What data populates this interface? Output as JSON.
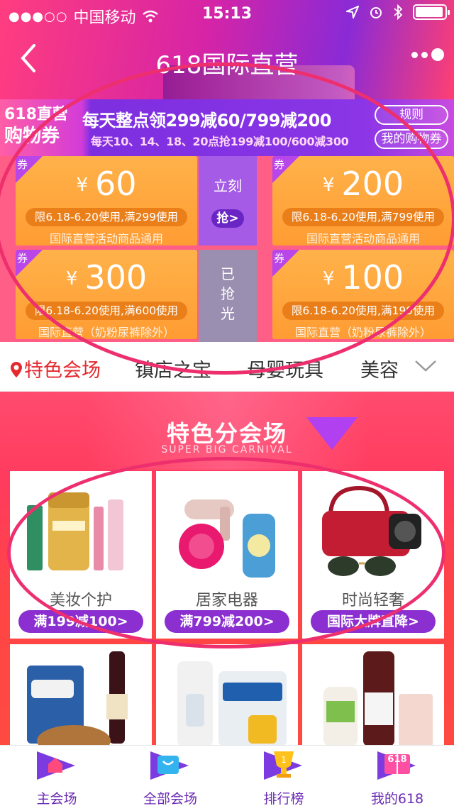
{
  "status_bar": {
    "carrier": "中国移动",
    "time": "15:13"
  },
  "nav": {
    "title": "618国际直营"
  },
  "coupon_banner": {
    "left_line1": "618直营",
    "left_line2": "购物券",
    "line1": "每天整点领299减60/799减200",
    "line2": "每天10、14、18、20点抢199减100/600减300",
    "rule_button": "规则",
    "mine_button": "我的购物券"
  },
  "coupons": [
    {
      "tag": "券",
      "currency": "¥",
      "amount": "60",
      "limit": "限6.18-6.20使用,满299使用",
      "scope": "国际直营活动商品通用"
    },
    {
      "tag": "券",
      "currency": "¥",
      "amount": "200",
      "limit": "限6.18-6.20使用,满799使用",
      "scope": "国际直营活动商品通用"
    },
    {
      "tag": "券",
      "currency": "¥",
      "amount": "300",
      "limit": "限6.18-6.20使用,满600使用",
      "scope": "国际直营（奶粉尿裤除外）"
    },
    {
      "tag": "券",
      "currency": "¥",
      "amount": "100",
      "limit": "限6.18-6.20使用,满199使用",
      "scope": "国际直营（奶粉尿裤除外）"
    }
  ],
  "grab": {
    "label": "立刻",
    "button": "抢>"
  },
  "soldout": {
    "line1": "已",
    "line2": "抢",
    "line3": "光"
  },
  "tabs": {
    "active": "特色会场",
    "t2": "镇店之宝",
    "t3": "母婴玩具",
    "t4": "美容"
  },
  "venue": {
    "title": "特色分会场",
    "subtitle": "SUPER BIG CARNIVAL"
  },
  "cards": [
    {
      "name": "美妆个护",
      "deal": "满199减100>"
    },
    {
      "name": "居家电器",
      "deal": "满799减200>"
    },
    {
      "name": "时尚轻奢",
      "deal": "国际大牌直降>"
    }
  ],
  "bottom_tabs": {
    "home": "主会场",
    "all": "全部会场",
    "rank": "排行榜",
    "mine": "我的618",
    "mine_badge": "618"
  },
  "colors": {
    "accent_pink": "#ff3d7f",
    "accent_purple": "#8a2ad6",
    "coupon_orange": "#ff9c33",
    "annotation": "#ee2f6e"
  }
}
